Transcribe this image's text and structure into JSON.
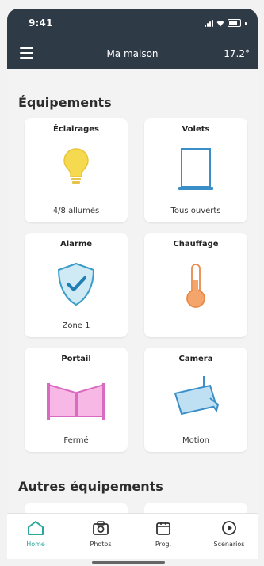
{
  "status_bar": {
    "time": "9:41"
  },
  "header": {
    "title": "Ma maison",
    "temperature": "17.2°"
  },
  "sections": [
    {
      "title": "Équipements"
    },
    {
      "title": "Autres équipements"
    }
  ],
  "devices": [
    {
      "title": "Éclairages",
      "status": "4/8 allumés",
      "icon": "lightbulb-icon"
    },
    {
      "title": "Volets",
      "status": "Tous ouverts",
      "icon": "shutter-icon"
    },
    {
      "title": "Alarme",
      "status": "Zone 1",
      "icon": "shield-check-icon"
    },
    {
      "title": "Chauffage",
      "status": "",
      "icon": "thermometer-icon"
    },
    {
      "title": "Portail",
      "status": "Fermé",
      "icon": "gate-icon"
    },
    {
      "title": "Camera",
      "status": "Motion",
      "icon": "camera-icon"
    }
  ],
  "nav": [
    {
      "label": "Home",
      "icon": "home-icon",
      "active": true
    },
    {
      "label": "Photos",
      "icon": "camera-icon"
    },
    {
      "label": "Prog.",
      "icon": "calendar-icon"
    },
    {
      "label": "Scenarios",
      "icon": "play-icon"
    }
  ],
  "colors": {
    "header_bg": "#2f3a47",
    "accent": "#2aa79b",
    "bulb": "#f5d94e",
    "shutter": "#3a8fc9",
    "shield": "#5ab4d9",
    "thermo": "#f3a56b",
    "gate": "#f29bd9",
    "camera": "#8ec7e8"
  }
}
